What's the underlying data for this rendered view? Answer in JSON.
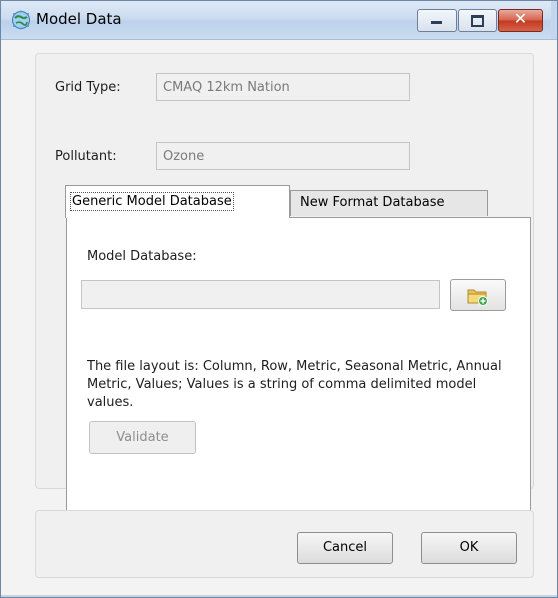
{
  "window": {
    "title": "Model Data"
  },
  "form": {
    "grid_type_label": "Grid Type:",
    "grid_type_value": "CMAQ 12km Nation",
    "pollutant_label": "Pollutant:",
    "pollutant_value": "Ozone"
  },
  "tabs": [
    {
      "label": "Generic Model Database",
      "active": true
    },
    {
      "label": "New Format Database",
      "active": false
    }
  ],
  "panel": {
    "model_database_label": "Model Database:",
    "model_database_value": "",
    "description": "The file layout is: Column, Row, Metric, Seasonal Metric, Annual Metric, Values; Values is a string of comma delimited model values.",
    "validate_label": "Validate",
    "browse_icon": "folder-add-icon"
  },
  "footer": {
    "cancel_label": "Cancel",
    "ok_label": "OK"
  },
  "colors": {
    "title_gradient_top": "#dfe9f5",
    "close_button": "#c4391f",
    "panel_bg": "#ffffff",
    "dialog_bg": "#f0f0f0"
  }
}
